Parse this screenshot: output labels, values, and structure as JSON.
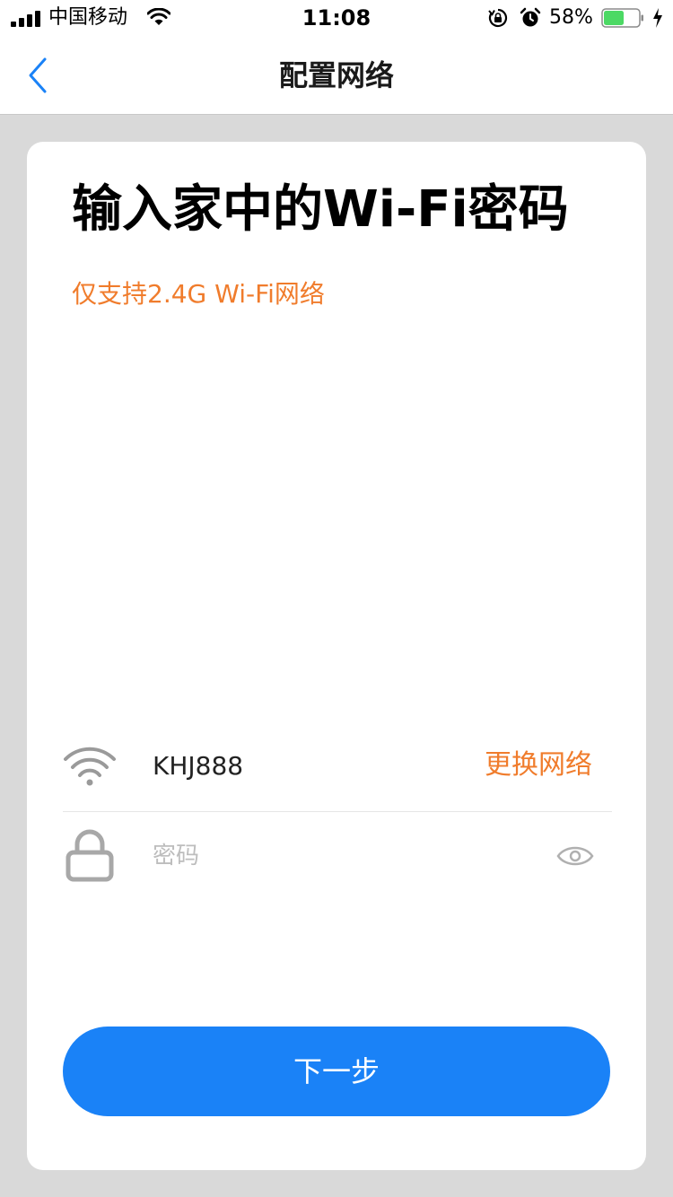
{
  "status_bar": {
    "carrier": "中国移动",
    "time": "11:08",
    "battery_percent": "58%",
    "battery_level": 0.58,
    "battery_color": "#4cd964"
  },
  "nav": {
    "title": "配置网络",
    "back_icon": "chevron-left-icon",
    "accent_color": "#1a82f7"
  },
  "card": {
    "title": "输入家中的Wi-Fi密码",
    "subtitle": "仅支持2.4G Wi-Fi网络",
    "network": {
      "ssid": "KHJ888",
      "change_label": "更换网络",
      "icon": "wifi-icon"
    },
    "password": {
      "value": "",
      "placeholder": "密码",
      "lock_icon": "lock-icon",
      "visibility_icon": "eye-icon"
    },
    "next_label": "下一步"
  },
  "colors": {
    "accent_orange": "#f07c2c",
    "primary_blue": "#1a82f7",
    "background": "#d9d9d9"
  }
}
